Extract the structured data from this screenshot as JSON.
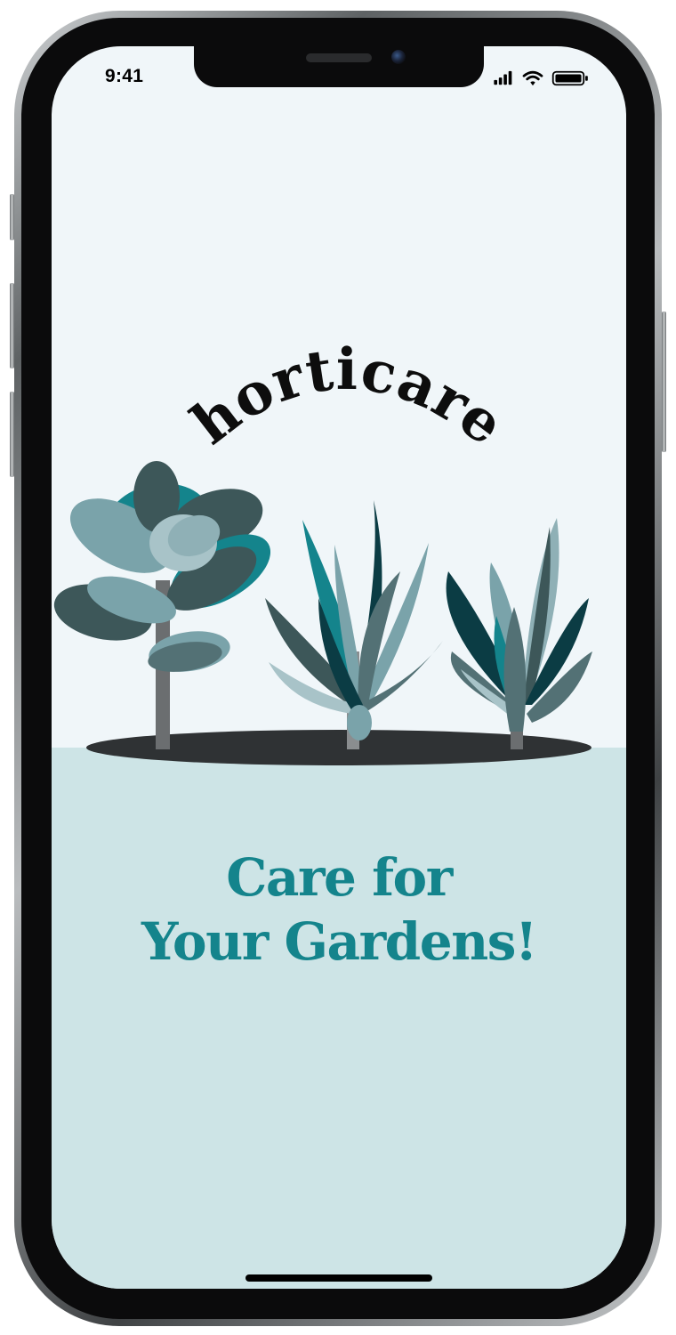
{
  "status_bar": {
    "time": "9:41"
  },
  "app": {
    "wordmark": "horticare",
    "tagline_line1": "Care for",
    "tagline_line2": "Your Gardens!"
  },
  "colors": {
    "sky": "#f0f6f9",
    "ground": "#cde4e6",
    "accent_teal": "#14848c",
    "shadow": "#2f3234",
    "stem": "#6b6e70"
  },
  "icons": {
    "signal": "cellular-signal-icon",
    "wifi": "wifi-icon",
    "battery": "battery-icon"
  }
}
